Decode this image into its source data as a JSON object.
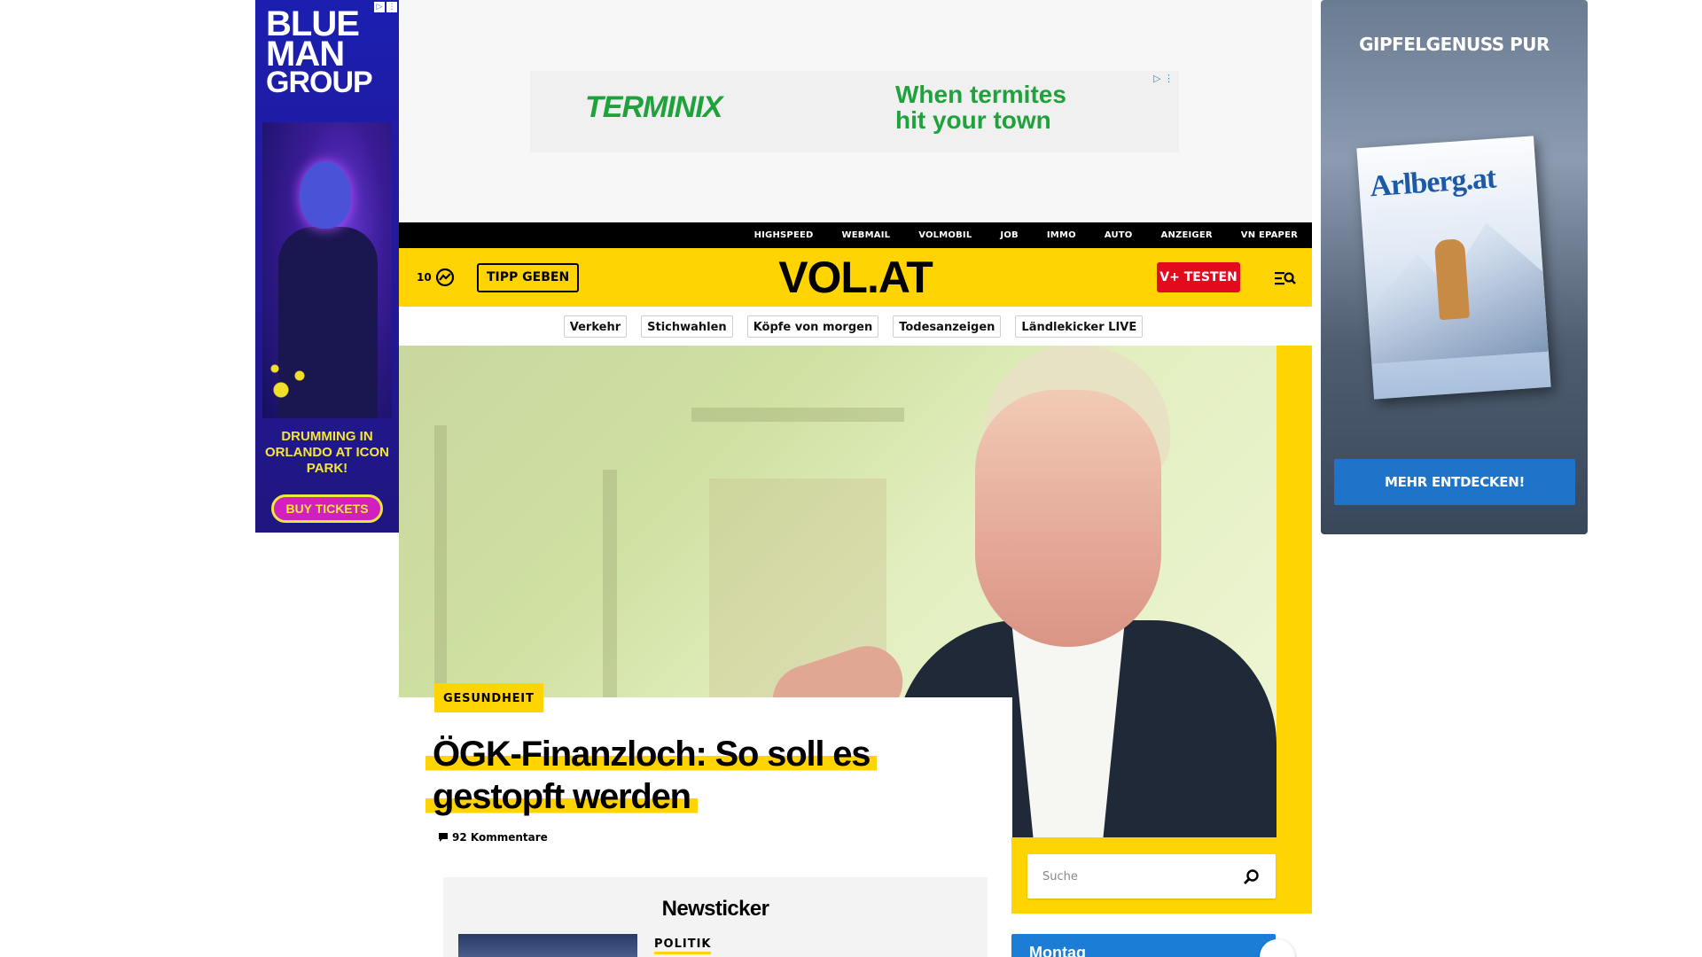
{
  "ads": {
    "left": {
      "brand_line1": "BLUE",
      "brand_line2": "MAN",
      "brand_line3": "GROUP",
      "text": "DRUMMING IN ORLANDO AT ICON PARK!",
      "button": "BUY TICKETS"
    },
    "leaderboard": {
      "brand": "TERMINIX",
      "slogan_line1": "When termites",
      "slogan_line2": "hit your town"
    },
    "right": {
      "headline": "GIPFELGENUSS PUR",
      "magazine_title": "Arlberg.at",
      "cta": "MEHR ENTDECKEN!"
    }
  },
  "top_links": [
    "HIGHSPEED",
    "WEBMAIL",
    "VOLMOBIL",
    "JOB",
    "IMMO",
    "AUTO",
    "ANZEIGER",
    "VN EPAPER"
  ],
  "header": {
    "counter": "10",
    "tipp_label": "TIPP GEBEN",
    "logo": "VOL.AT",
    "vplus_label": "V+ TESTEN",
    "menu_icon": "menu-search-icon",
    "accent_color": "#ffd400",
    "cta_color": "#e30a1e"
  },
  "nav_pills": [
    "Verkehr",
    "Stichwahlen",
    "Köpfe von morgen",
    "Todesanzeigen",
    "Ländlekicker LIVE"
  ],
  "hero": {
    "category": "GESUNDHEIT",
    "headline_line1": "ÖGK-Finanzloch: So soll es",
    "headline_line2": "gestopft werden",
    "comments": "92 Kommentare"
  },
  "newsticker": {
    "title": "Newsticker",
    "first_kicker": "POLITIK"
  },
  "search": {
    "placeholder": "Suche"
  },
  "day_widget": {
    "label": "Montag"
  }
}
